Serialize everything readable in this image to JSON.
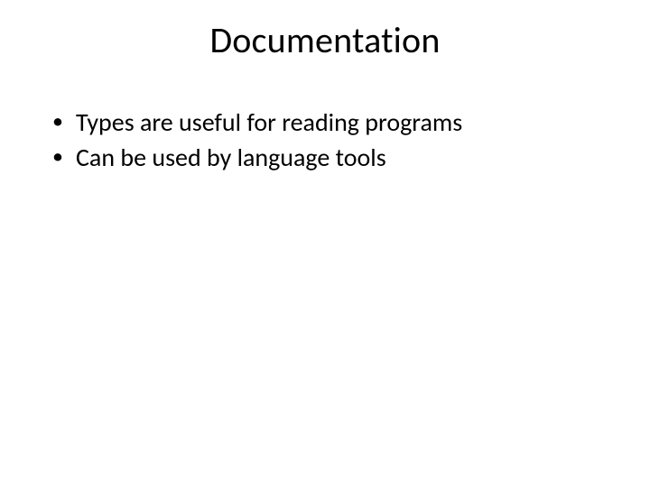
{
  "slide": {
    "title": "Documentation",
    "bullets": [
      "Types are useful for reading programs",
      "Can be used by language tools"
    ]
  }
}
